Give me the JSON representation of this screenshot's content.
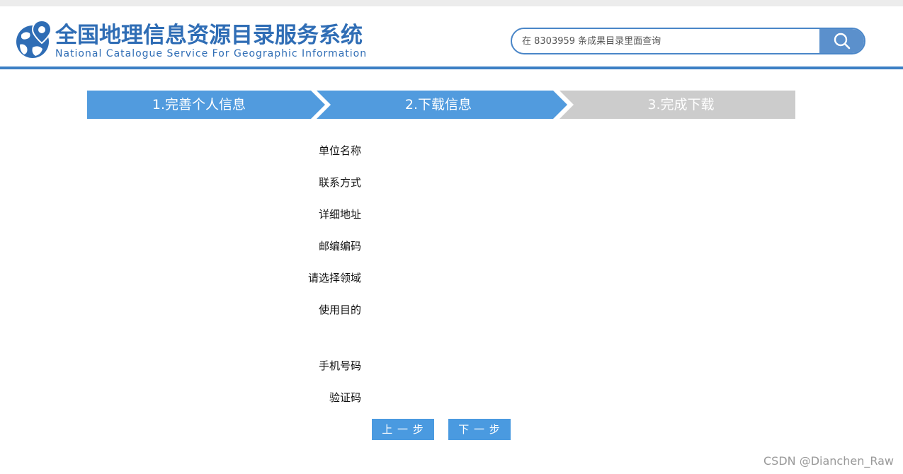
{
  "header": {
    "title_cn": "全国地理信息资源目录服务系统",
    "title_en": "National Catalogue Service For Geographic Information",
    "logo_icon": "globe-pin-icon",
    "brand_color": "#2f6db5"
  },
  "search": {
    "placeholder": "在 8303959 条成果目录里面查询",
    "button_icon": "search-icon"
  },
  "steps": {
    "items": [
      {
        "label": "1.完善个人信息",
        "state": "done"
      },
      {
        "label": "2.下载信息",
        "state": "active"
      },
      {
        "label": "3.完成下载",
        "state": "pending"
      }
    ],
    "active_color": "#519bde",
    "pending_color": "#cccccc"
  },
  "form": {
    "fields": [
      {
        "label": "单位名称"
      },
      {
        "label": "联系方式"
      },
      {
        "label": "详细地址"
      },
      {
        "label": "邮编编码"
      },
      {
        "label": "请选择领域"
      },
      {
        "label": "使用目的"
      },
      {
        "label": "手机号码"
      },
      {
        "label": "验证码"
      }
    ]
  },
  "buttons": {
    "prev": "上 一 步",
    "next": "下 一 步",
    "color": "#4a9ae0"
  },
  "watermark": "CSDN @Dianchen_Raw"
}
